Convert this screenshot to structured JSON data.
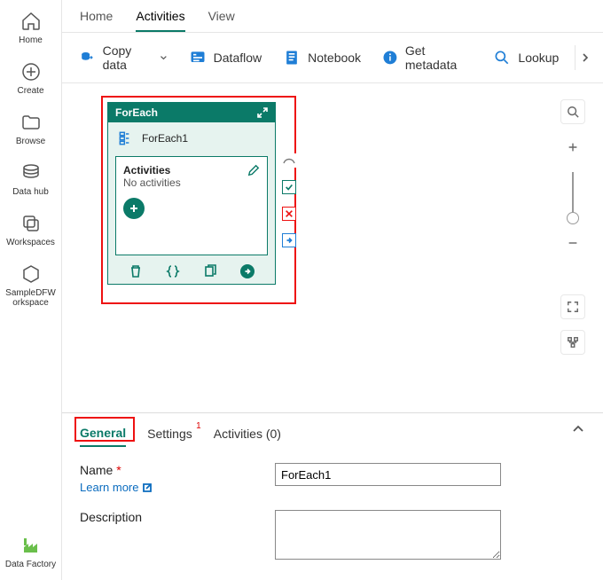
{
  "rail": [
    {
      "id": "home",
      "label": "Home"
    },
    {
      "id": "create",
      "label": "Create"
    },
    {
      "id": "browse",
      "label": "Browse"
    },
    {
      "id": "datahub",
      "label": "Data hub"
    },
    {
      "id": "workspaces",
      "label": "Workspaces"
    },
    {
      "id": "sampledfw",
      "label": "SampleDFW\norkspace"
    }
  ],
  "rail_bottom": {
    "id": "datafactory",
    "label": "Data Factory"
  },
  "top_tabs": [
    {
      "label": "Home",
      "active": false
    },
    {
      "label": "Activities",
      "active": true
    },
    {
      "label": "View",
      "active": false
    }
  ],
  "toolbar": [
    {
      "id": "copydata",
      "label": "Copy data",
      "has_chevron": true
    },
    {
      "id": "dataflow",
      "label": "Dataflow"
    },
    {
      "id": "notebook",
      "label": "Notebook"
    },
    {
      "id": "getmetadata",
      "label": "Get metadata"
    },
    {
      "id": "lookup",
      "label": "Lookup"
    }
  ],
  "foreach": {
    "header": "ForEach",
    "name": "ForEach1",
    "activities_header": "Activities",
    "activities_empty": "No activities"
  },
  "prop_tabs": [
    {
      "label": "General",
      "active": true
    },
    {
      "label": "Settings",
      "badge": "1"
    },
    {
      "label": "Activities (0)"
    }
  ],
  "form": {
    "name_label": "Name",
    "name_value": "ForEach1",
    "learn_more": "Learn more",
    "desc_label": "Description",
    "desc_value": ""
  }
}
